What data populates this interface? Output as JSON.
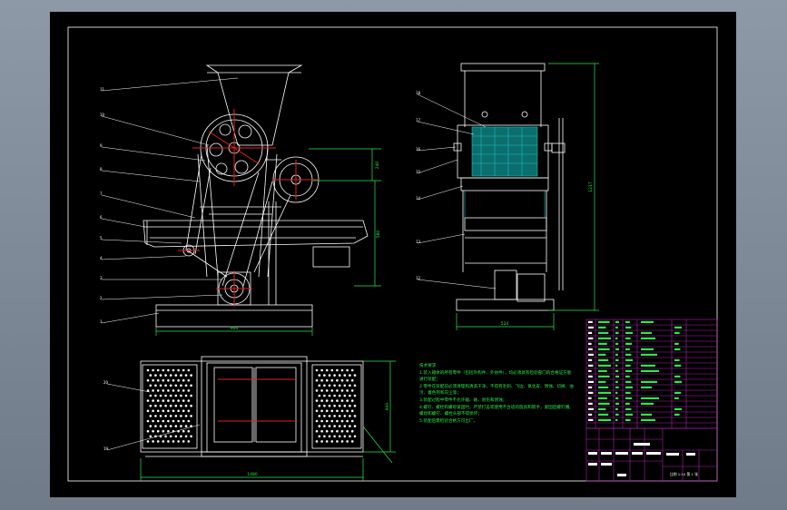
{
  "colors": {
    "background": "#7d8995",
    "sheet": "#000000",
    "linework": "#ffffff",
    "accent": "#e02020",
    "dimension": "#2ee84a",
    "title_block": "#b020b0",
    "hatch": "#18c0c0"
  },
  "drawing": {
    "front_view_labels": [
      "11",
      "10",
      "9",
      "8",
      "7",
      "6",
      "5",
      "4",
      "3",
      "2",
      "1"
    ],
    "side_view_labels": [
      "18",
      "17",
      "16",
      "15",
      "14",
      "13",
      "12"
    ],
    "plan_view_labels": [
      "20",
      "19"
    ],
    "dims": {
      "front_height_upper": "240",
      "front_height_total": "580",
      "front_width": "904",
      "side_height": "1217",
      "side_width": "524",
      "plan_width": "1480",
      "plan_depth": "900"
    },
    "notes_title": "技术要求",
    "notes": [
      "1.装入箱体的所有零件（包括外购件、外协件），均必须具有检验部门的合格证方能进行装配；",
      "2.零件在装配前必须清理和清洗干净，不得有毛刺、飞边、氧化皮、锈蚀、切屑、油污、着色剂和灰尘等；",
      "3.装配过程中零件不允许磕、碰、划伤和锈蚀；",
      "4.螺钉、螺栓和螺母紧固时，严禁打击或使用不合适的旋具和扳手，紧固后螺钉槽、螺母和螺钉、螺栓头部不得损坏；",
      "5.装配后需检验合格方可出厂。"
    ],
    "scale_text": "比例 1:10 第 1 张"
  }
}
